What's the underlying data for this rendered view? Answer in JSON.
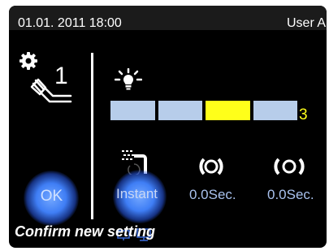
{
  "status": {
    "datetime": "01.01. 2011 18:00",
    "user": "User A"
  },
  "instrument": {
    "number": "1"
  },
  "light": {
    "level": 3,
    "segments_total": 4,
    "active_segment": 3,
    "level_label": "3"
  },
  "options": {
    "instant_label": "Instant",
    "delay_closed": "0.0Sec.",
    "delay_open": "0.0Sec."
  },
  "buttons": {
    "ok_label": "OK"
  },
  "prompt": {
    "text": "Confirm new setting"
  },
  "colors": {
    "screen_bg": "#000000",
    "status_bar": "#1b1b1b",
    "accent_yellow": "#ffff1a",
    "segment_blue": "#b7cdea",
    "glow_blue": "#3f7ef5"
  },
  "icons": [
    "gear-icon",
    "handpiece-icon",
    "light-bulb-icon",
    "spray-icon",
    "ring-closed-icon",
    "ring-open-icon"
  ]
}
